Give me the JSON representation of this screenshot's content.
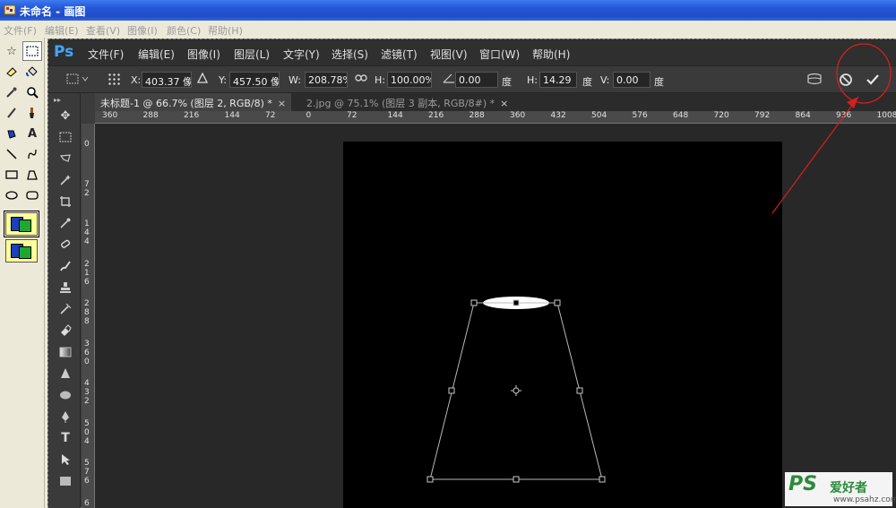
{
  "window": {
    "title": "未命名 - 画图"
  },
  "paint_menu": [
    "文件(F)",
    "编辑(E)",
    "查看(V)",
    "图像(I)",
    "颜色(C)",
    "帮助(H)"
  ],
  "ps_logo": "Ps",
  "ps_menu": [
    "文件(F)",
    "编辑(E)",
    "图像(I)",
    "图层(L)",
    "文字(Y)",
    "选择(S)",
    "滤镜(T)",
    "视图(V)",
    "窗口(W)",
    "帮助(H)"
  ],
  "options": {
    "x_label": "X:",
    "x_value": "403.37 像素",
    "y_label": "Y:",
    "y_value": "457.50 像素",
    "w_label": "W:",
    "w_value": "208.78%",
    "h_label": "H:",
    "h_value": "100.00%",
    "angle_value": "0.00",
    "angle_unit": "度",
    "hskew_label": "H:",
    "hskew_value": "14.29",
    "hskew_unit": "度",
    "vskew_label": "V:",
    "vskew_value": "0.00",
    "vskew_unit": "度"
  },
  "tabs": [
    {
      "label": "未标题-1 @ 66.7% (图层 2, RGB/8) *",
      "close": "×",
      "active": true
    },
    {
      "label": "2.jpg @ 75.1% (图层 3 副本, RGB/8#) *",
      "close": "×",
      "active": false
    }
  ],
  "ruler_top": [
    "360",
    "288",
    "216",
    "144",
    "72",
    "0",
    "72",
    "144",
    "216",
    "288",
    "360",
    "432",
    "504",
    "576",
    "648",
    "720",
    "792",
    "864",
    "936",
    "1008"
  ],
  "ruler_left": [
    "0",
    "72",
    "144",
    "216",
    "288",
    "360",
    "432",
    "504",
    "576",
    "6"
  ],
  "annotation_color": "#d42020",
  "watermark": {
    "logo": "PS",
    "text": "爱好者",
    "url": "www.psahz.com"
  }
}
